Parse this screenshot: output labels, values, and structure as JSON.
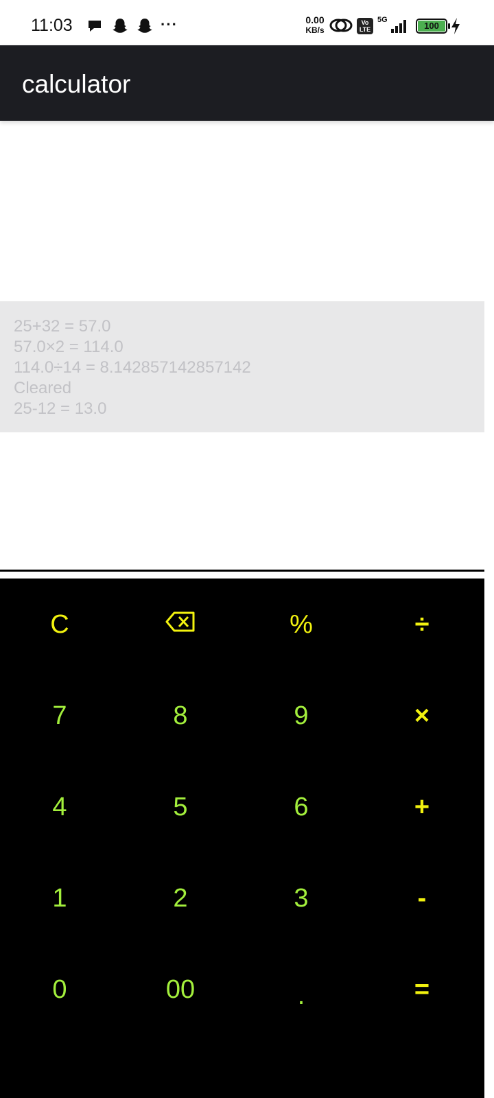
{
  "status_bar": {
    "time": "11:03",
    "net_speed_value": "0.00",
    "net_speed_unit": "KB/s",
    "volte_label": "Vo LTE",
    "network_type": "5G",
    "battery": "100"
  },
  "app_bar": {
    "title": "calculator"
  },
  "history": [
    " 25+32 = 57.0",
    "57.0×2 = 114.0",
    "114.0÷14 = 8.142857142857142",
    "Cleared",
    " 25-12 = 13.0"
  ],
  "keypad": {
    "rows": [
      [
        "C",
        "backspace-icon",
        "%",
        "÷"
      ],
      [
        "7",
        "8",
        "9",
        "×"
      ],
      [
        "4",
        "5",
        "6",
        "+"
      ],
      [
        "1",
        "2",
        "3",
        "-"
      ],
      [
        "0",
        "00",
        ".",
        "="
      ]
    ],
    "colors": {
      "digit": "#a3ef3c",
      "function": "#f2f20f",
      "background": "#000000"
    }
  }
}
